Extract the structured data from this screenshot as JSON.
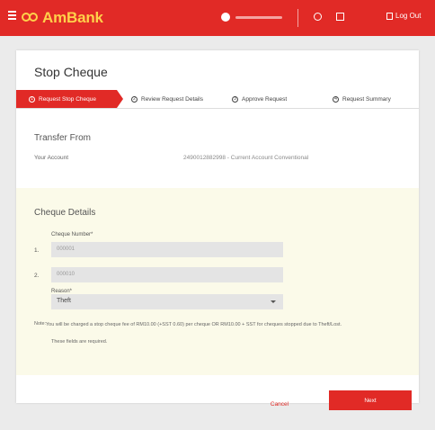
{
  "header": {
    "logo_text": "AmBank",
    "user_name": "",
    "logout_label": "Log Out"
  },
  "page": {
    "title": "Stop Cheque"
  },
  "steps": [
    {
      "num": "1",
      "label": "Request Stop Cheque",
      "active": true
    },
    {
      "num": "2",
      "label": "Review Request Details",
      "active": false
    },
    {
      "num": "3",
      "label": "Approve Request",
      "active": false
    },
    {
      "num": "4",
      "label": "Request Summary",
      "active": false
    }
  ],
  "transfer_from": {
    "title": "Transfer From",
    "label": "Your Account",
    "value": "2490012882998 - Current Account Conventional"
  },
  "cheque_details": {
    "title": "Cheque Details",
    "column_header": "Cheque Number*",
    "rows": [
      {
        "num": "1.",
        "placeholder": "000001"
      },
      {
        "num": "2.",
        "placeholder": "000010"
      }
    ],
    "reason_label": "Reason*",
    "reason_value": "Theft",
    "note_label": "Note:",
    "note_text": "You will be charged a stop cheque fee of RM10.00 (+SST 0.60) per cheque OR RM10.00 + SST for cheques stopped due to Theft/Lost.",
    "note_required": "These fields are required."
  },
  "actions": {
    "cancel_label": "Cancel",
    "next_label": "Next"
  },
  "colors": {
    "brand_red": "#e12a26",
    "logo_yellow": "#ffd04a",
    "panel_bg": "#fbfae9"
  }
}
